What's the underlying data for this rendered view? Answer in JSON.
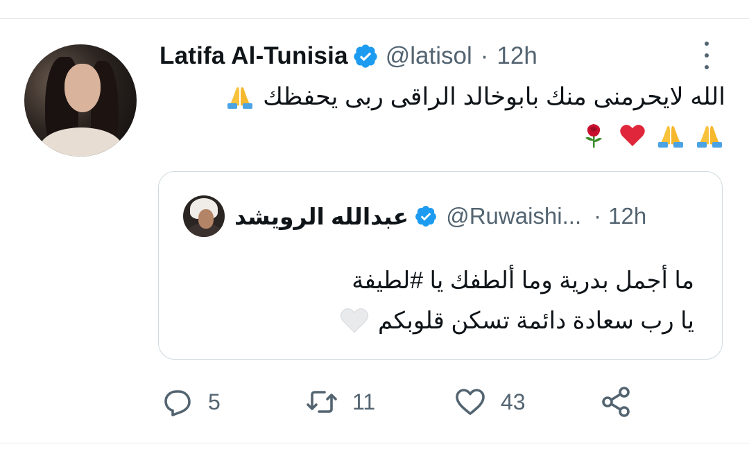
{
  "tweet": {
    "author_name": "Latifa Al-Tunisia",
    "handle": "@latisol",
    "separator": "·",
    "time": "12h",
    "text_line1": "الله لايحرمنى منك بابوخالد الراقى ربى يحفظك",
    "icons": {
      "verified": "verified-badge-icon",
      "more": "more-options-icon",
      "emoji_pray": "folded-hands-emoji",
      "emoji_heart": "red-heart-emoji",
      "emoji_rose": "rose-emoji"
    }
  },
  "quote": {
    "author_name": "عبدالله الرويشد",
    "handle": "@Ruwaishi...",
    "separator": "·",
    "time": "12h",
    "text_line1": "ما أجمل بدرية وما ألطفك يا #لطيفة",
    "text_line2": "يا رب سعادة دائمة تسكن قلوبكم",
    "icons": {
      "white_heart": "white-heart-emoji"
    }
  },
  "actions": {
    "reply_count": "5",
    "retweet_count": "11",
    "like_count": "43"
  },
  "colors": {
    "verified_blue": "#1d9bf0",
    "secondary_text": "#536471",
    "primary_text": "#0f1419",
    "border": "#cfd9de"
  }
}
